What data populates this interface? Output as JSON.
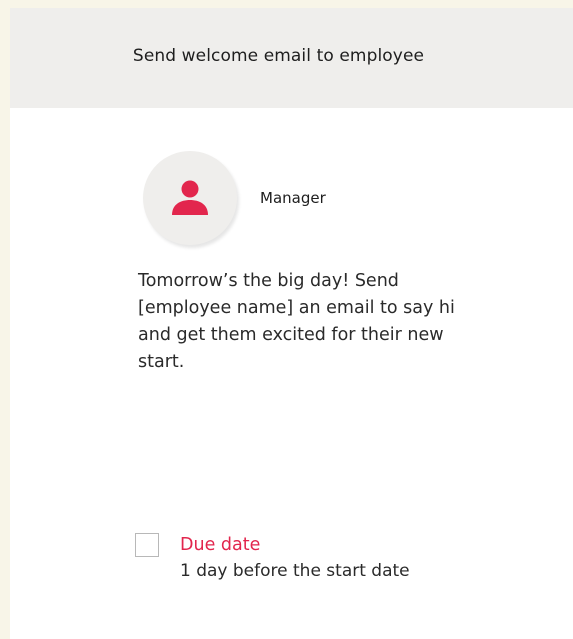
{
  "task": {
    "title": "Send welcome email to employee",
    "assignee_role": "Manager",
    "assignee_icon": "person-icon",
    "description": "Tomorrow’s the big day! Send [employee name] an email to say hi and get them excited for their new start.",
    "due_label": "Due date",
    "due_value": "1 day before the start date"
  },
  "colors": {
    "accent": "#e2264d",
    "header_bg": "#efeeec",
    "page_bg": "#f8f5e8"
  }
}
